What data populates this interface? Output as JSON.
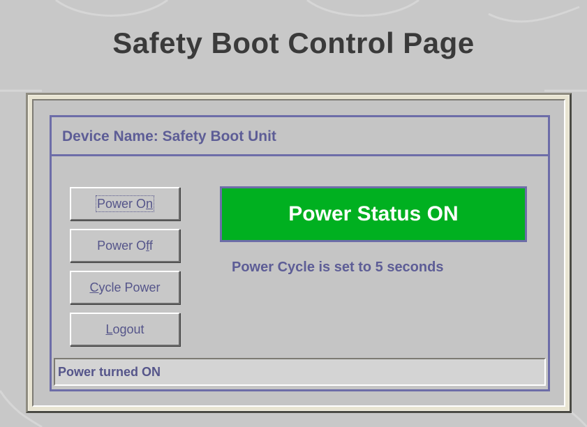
{
  "page": {
    "title": "Safety Boot Control Page"
  },
  "device": {
    "label": "Device Name: Safety Boot Unit"
  },
  "buttons": {
    "power_on": {
      "label": "Power On",
      "mnemonic": "n"
    },
    "power_off": {
      "label": "Power Off",
      "mnemonic": "f"
    },
    "cycle_power": {
      "label": "Cycle Power",
      "mnemonic": "C"
    },
    "logout": {
      "label": "Logout",
      "mnemonic": "L"
    }
  },
  "status": {
    "power_text": "Power Status ON",
    "cycle_text": "Power Cycle is set to 5 seconds",
    "message": "Power turned ON"
  },
  "colors": {
    "status_on": "#00b020",
    "panel_border": "#6d6da8",
    "text_accent": "#5d5d96",
    "background": "#c8c8c8"
  }
}
